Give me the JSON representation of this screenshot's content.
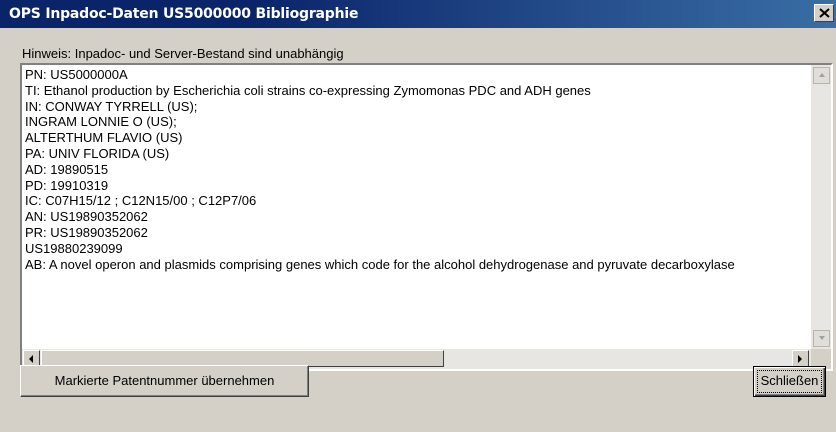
{
  "window": {
    "title": "OPS Inpadoc-Daten US5000000 Bibliographie"
  },
  "hint": "Hinweis: Inpadoc- und Server-Bestand sind unabhängig",
  "record_lines": [
    "PN: US5000000A",
    "TI: Ethanol production by Escherichia coli strains co-expressing Zymomonas PDC and ADH genes",
    "IN: CONWAY TYRRELL (US);",
    "INGRAM LONNIE O (US);",
    "ALTERTHUM FLAVIO (US)",
    "PA: UNIV FLORIDA (US)",
    "AD: 19890515",
    "PD: 19910319",
    "IC: C07H15/12 ; C12N15/00 ; C12P7/06",
    "AN: US19890352062",
    "PR: US19890352062",
    "US19880239099",
    "AB: A novel operon and plasmids comprising genes which code for the alcohol dehydrogenase and pyruvate decarboxylase"
  ],
  "buttons": {
    "adopt_label": "Markierte Patentnummer übernehmen",
    "close_label": "Schließen"
  },
  "icons": {
    "close": "close-icon",
    "scroll_up": "arrow-up-icon",
    "scroll_down": "arrow-down-icon",
    "scroll_left": "arrow-left-icon",
    "scroll_right": "arrow-right-icon"
  },
  "colors": {
    "title_bar": "#0a246a",
    "face": "#d4d0c8"
  }
}
